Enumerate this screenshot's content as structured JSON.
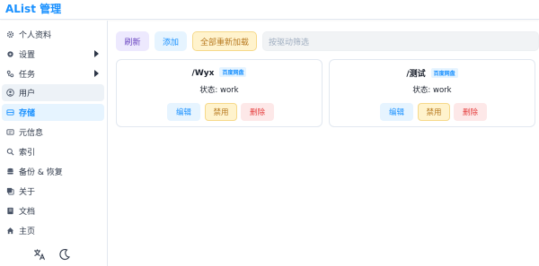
{
  "app": {
    "title": "AList 管理"
  },
  "sidebar": {
    "items": [
      {
        "label": "个人资料",
        "icon": "gear-icon",
        "state": "normal",
        "has_submenu": false
      },
      {
        "label": "设置",
        "icon": "settings-icon",
        "state": "normal",
        "has_submenu": true
      },
      {
        "label": "任务",
        "icon": "task-icon",
        "state": "normal",
        "has_submenu": true
      },
      {
        "label": "用户",
        "icon": "user-icon",
        "state": "hover",
        "has_submenu": false
      },
      {
        "label": "存储",
        "icon": "storage-icon",
        "state": "active",
        "has_submenu": false
      },
      {
        "label": "元信息",
        "icon": "meta-icon",
        "state": "normal",
        "has_submenu": false
      },
      {
        "label": "索引",
        "icon": "search-icon",
        "state": "normal",
        "has_submenu": false
      },
      {
        "label": "备份 & 恢复",
        "icon": "database-icon",
        "state": "normal",
        "has_submenu": false
      },
      {
        "label": "关于",
        "icon": "copy-icon",
        "state": "normal",
        "has_submenu": false
      },
      {
        "label": "文档",
        "icon": "book-icon",
        "state": "normal",
        "has_submenu": false
      },
      {
        "label": "主页",
        "icon": "home-icon",
        "state": "normal",
        "has_submenu": false
      }
    ],
    "footer": {
      "language_icon": "translate-icon",
      "theme_icon": "moon-icon"
    }
  },
  "toolbar": {
    "refresh_label": "刷新",
    "add_label": "添加",
    "reload_all_label": "全部重新加载",
    "search_placeholder": "按驱动筛选"
  },
  "storages": [
    {
      "path": "/Wyx",
      "driver": "百度网盘",
      "status_label": "状态: work",
      "edit_label": "编辑",
      "disable_label": "禁用",
      "delete_label": "删除"
    },
    {
      "path": "/测试",
      "driver": "百度网盘",
      "status_label": "状态: work",
      "edit_label": "编辑",
      "disable_label": "禁用",
      "delete_label": "删除"
    }
  ],
  "colors": {
    "accent": "#1890ff",
    "purple": "#6b46c1",
    "warning": "#b7791f",
    "danger": "#e53e3e"
  }
}
